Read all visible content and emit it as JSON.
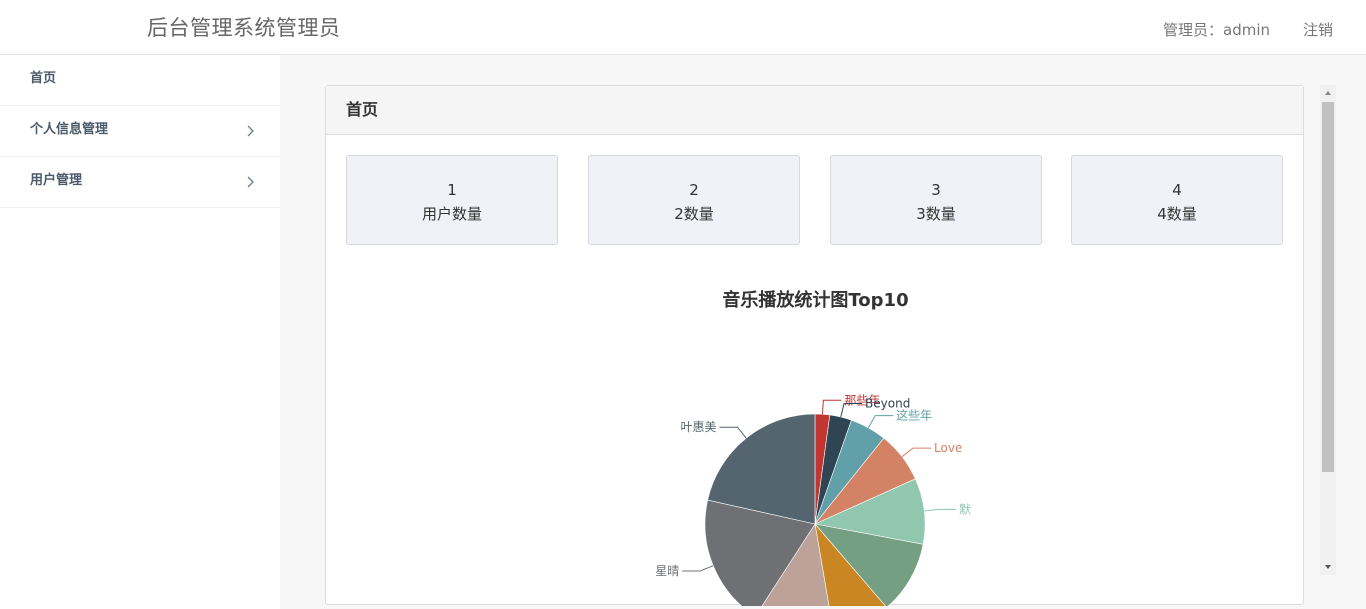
{
  "header": {
    "brand": "后台管理系统管理员",
    "admin_label": "管理员：admin",
    "logout_label": "注销"
  },
  "sidebar": {
    "items": [
      {
        "label": "首页",
        "has_chevron": false
      },
      {
        "label": "个人信息管理",
        "has_chevron": true
      },
      {
        "label": "用户管理",
        "has_chevron": true
      }
    ]
  },
  "panel": {
    "title": "首页"
  },
  "stats": [
    {
      "num": "1",
      "label": "用户数量"
    },
    {
      "num": "2",
      "label": "2数量"
    },
    {
      "num": "3",
      "label": "3数量"
    },
    {
      "num": "4",
      "label": "4数量"
    }
  ],
  "chart_data": {
    "type": "pie",
    "title": "音乐播放统计图Top10",
    "slices": [
      {
        "name": "那些年",
        "value": 2,
        "color": "#c23531",
        "labeled": true
      },
      {
        "name": "Beyond",
        "value": 3,
        "color": "#2f4554",
        "labeled": true
      },
      {
        "name": "这些年",
        "value": 5,
        "color": "#61a0a8",
        "labeled": true
      },
      {
        "name": "Love",
        "value": 7,
        "color": "#d48265",
        "labeled": true
      },
      {
        "name": "默",
        "value": 9,
        "color": "#91c7ae",
        "labeled": true
      },
      {
        "name": "",
        "value": 10,
        "color": "#749f83",
        "labeled": false
      },
      {
        "name": "",
        "value": 8,
        "color": "#ca8622",
        "labeled": false
      },
      {
        "name": "",
        "value": 11,
        "color": "#bda29a",
        "labeled": false
      },
      {
        "name": "星晴",
        "value": 18,
        "color": "#6e7074",
        "labeled": true
      },
      {
        "name": "叶惠美",
        "value": 20,
        "color": "#546570",
        "labeled": true
      }
    ]
  }
}
